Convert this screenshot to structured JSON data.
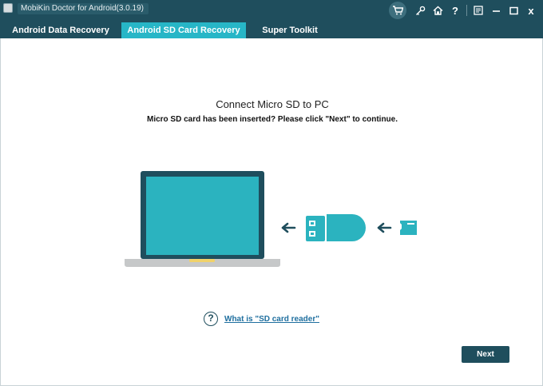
{
  "app": {
    "title": "MobiKin Doctor for Android(3.0.19)"
  },
  "toolbar": {
    "icons": [
      "cart-icon",
      "key-icon",
      "home-icon",
      "help-icon",
      "feedback-icon",
      "minimize-icon",
      "maximize-icon",
      "close-icon"
    ],
    "help_glyph": "?",
    "close_glyph": "x"
  },
  "tabs": [
    {
      "label": "Android Data Recovery",
      "active": false
    },
    {
      "label": "Android SD Card Recovery",
      "active": true
    },
    {
      "label": "Super Toolkit",
      "active": false
    }
  ],
  "main": {
    "heading": "Connect Micro SD to PC",
    "subheading": "Micro SD card has been inserted? Please click \"Next\" to continue.",
    "help_icon_glyph": "?",
    "help_link": "What is \"SD card reader\"",
    "next_button": "Next"
  },
  "colors": {
    "titlebar": "#1f4e5d",
    "active_tab": "#27b6c7",
    "accent": "#2bb3bf",
    "link": "#1f6f9f"
  }
}
